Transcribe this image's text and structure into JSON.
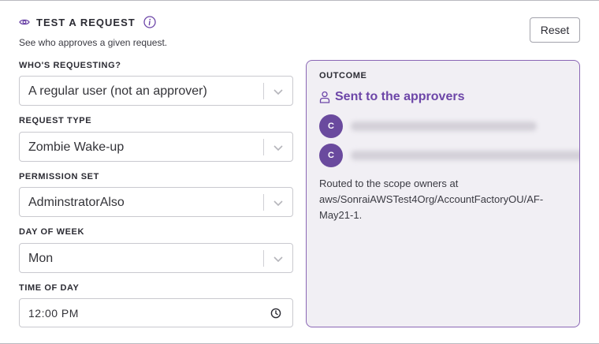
{
  "header": {
    "title": "TEST A REQUEST",
    "subtitle": "See who approves a given request.",
    "reset_label": "Reset"
  },
  "fields": {
    "whos_requesting": {
      "label": "WHO'S REQUESTING?",
      "value": "A regular user (not an approver)"
    },
    "request_type": {
      "label": "REQUEST TYPE",
      "value": "Zombie Wake-up"
    },
    "permission_set": {
      "label": "PERMISSION SET",
      "value": "AdminstratorAlso"
    },
    "day_of_week": {
      "label": "DAY OF WEEK",
      "value": "Mon"
    },
    "time_of_day": {
      "label": "TIME OF DAY",
      "value": "12:00 PM"
    }
  },
  "outcome": {
    "label": "OUTCOME",
    "status": "Sent to the approvers",
    "approvers": [
      {
        "initial": "C"
      },
      {
        "initial": "C"
      }
    ],
    "routed_text": "Routed to the scope owners at aws/SonraiAWSTest4Org/AccountFactoryOU/AF-May21-1."
  },
  "icons": {
    "eye": "eye-icon",
    "info": "info-icon",
    "chevron": "chevron-down-icon",
    "clock": "clock-icon",
    "person": "person-icon"
  },
  "colors": {
    "accent": "#6d46a8",
    "outcome_bg": "#f1eff4",
    "outcome_border": "#8a66b5",
    "avatar": "#6a4a9e"
  }
}
